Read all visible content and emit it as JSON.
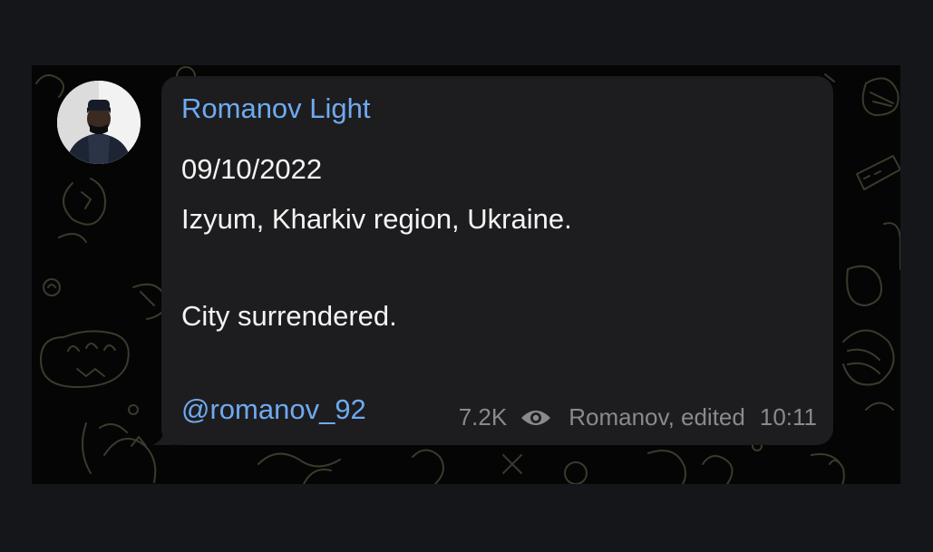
{
  "message": {
    "sender_name": "Romanov Light",
    "lines": {
      "date": "09/10/2022",
      "place": "Izyum, Kharkiv region, Ukraine.",
      "status": "City surrendered."
    },
    "channel_link": "@romanov_92",
    "views": "7.2K",
    "views_icon": "eye-icon",
    "author_edited": "Romanov, edited",
    "time": "10:11"
  },
  "colors": {
    "page_background": "#15161a",
    "chat_background": "#050505",
    "bubble": "#1d1d1f",
    "link": "#6faaf0",
    "text": "#f4f4f4",
    "meta": "#8a8a8d"
  }
}
